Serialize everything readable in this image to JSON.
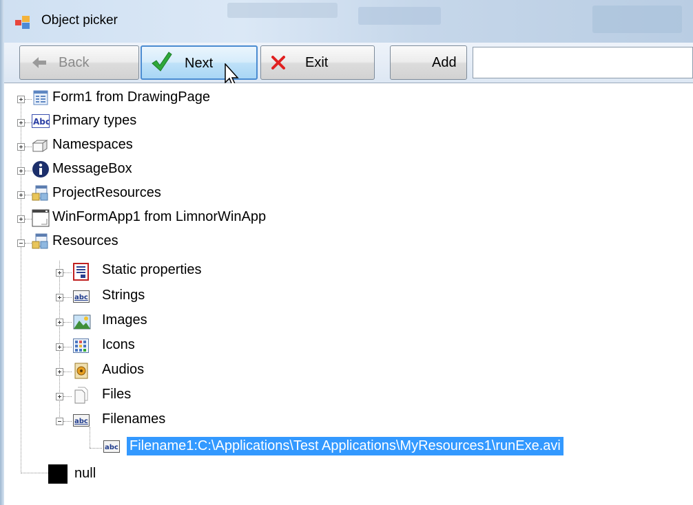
{
  "window": {
    "title": "Object picker"
  },
  "toolbar": {
    "back_label": "Back",
    "next_label": "Next",
    "exit_label": "Exit",
    "add_label": "Add",
    "add_value": ""
  },
  "tree": {
    "nodes": [
      {
        "label": "Form1 from DrawingPage",
        "icon": "form-icon",
        "expanded": false
      },
      {
        "label": "Primary types",
        "icon": "abc-type-icon",
        "expanded": false
      },
      {
        "label": "Namespaces",
        "icon": "namespace-icon",
        "expanded": false
      },
      {
        "label": "MessageBox",
        "icon": "info-icon",
        "expanded": false
      },
      {
        "label": "ProjectResources",
        "icon": "resources-icon",
        "expanded": false
      },
      {
        "label": "WinFormApp1 from LimnorWinApp",
        "icon": "window-app-icon",
        "expanded": false
      },
      {
        "label": "Resources",
        "icon": "resources-icon",
        "expanded": true
      },
      {
        "label": "Static properties",
        "icon": "static-properties-icon",
        "expanded": false
      },
      {
        "label": "Strings",
        "icon": "strings-icon",
        "expanded": false
      },
      {
        "label": "Images",
        "icon": "images-icon",
        "expanded": false
      },
      {
        "label": "Icons",
        "icon": "icons-icon",
        "expanded": false
      },
      {
        "label": "Audios",
        "icon": "audio-icon",
        "expanded": false
      },
      {
        "label": "Files",
        "icon": "files-icon",
        "expanded": false
      },
      {
        "label": "Filenames",
        "icon": "strings-icon",
        "expanded": true
      },
      {
        "label": "Filename1:C:\\Applications\\Test Applications\\MyResources1\\runExe.avi",
        "icon": "abc-value-icon",
        "selected": true
      },
      {
        "label": "null",
        "icon": "black-square-icon"
      }
    ]
  },
  "colors": {
    "selection": "#3399ff",
    "next_button_border": "#4a8bd1"
  }
}
